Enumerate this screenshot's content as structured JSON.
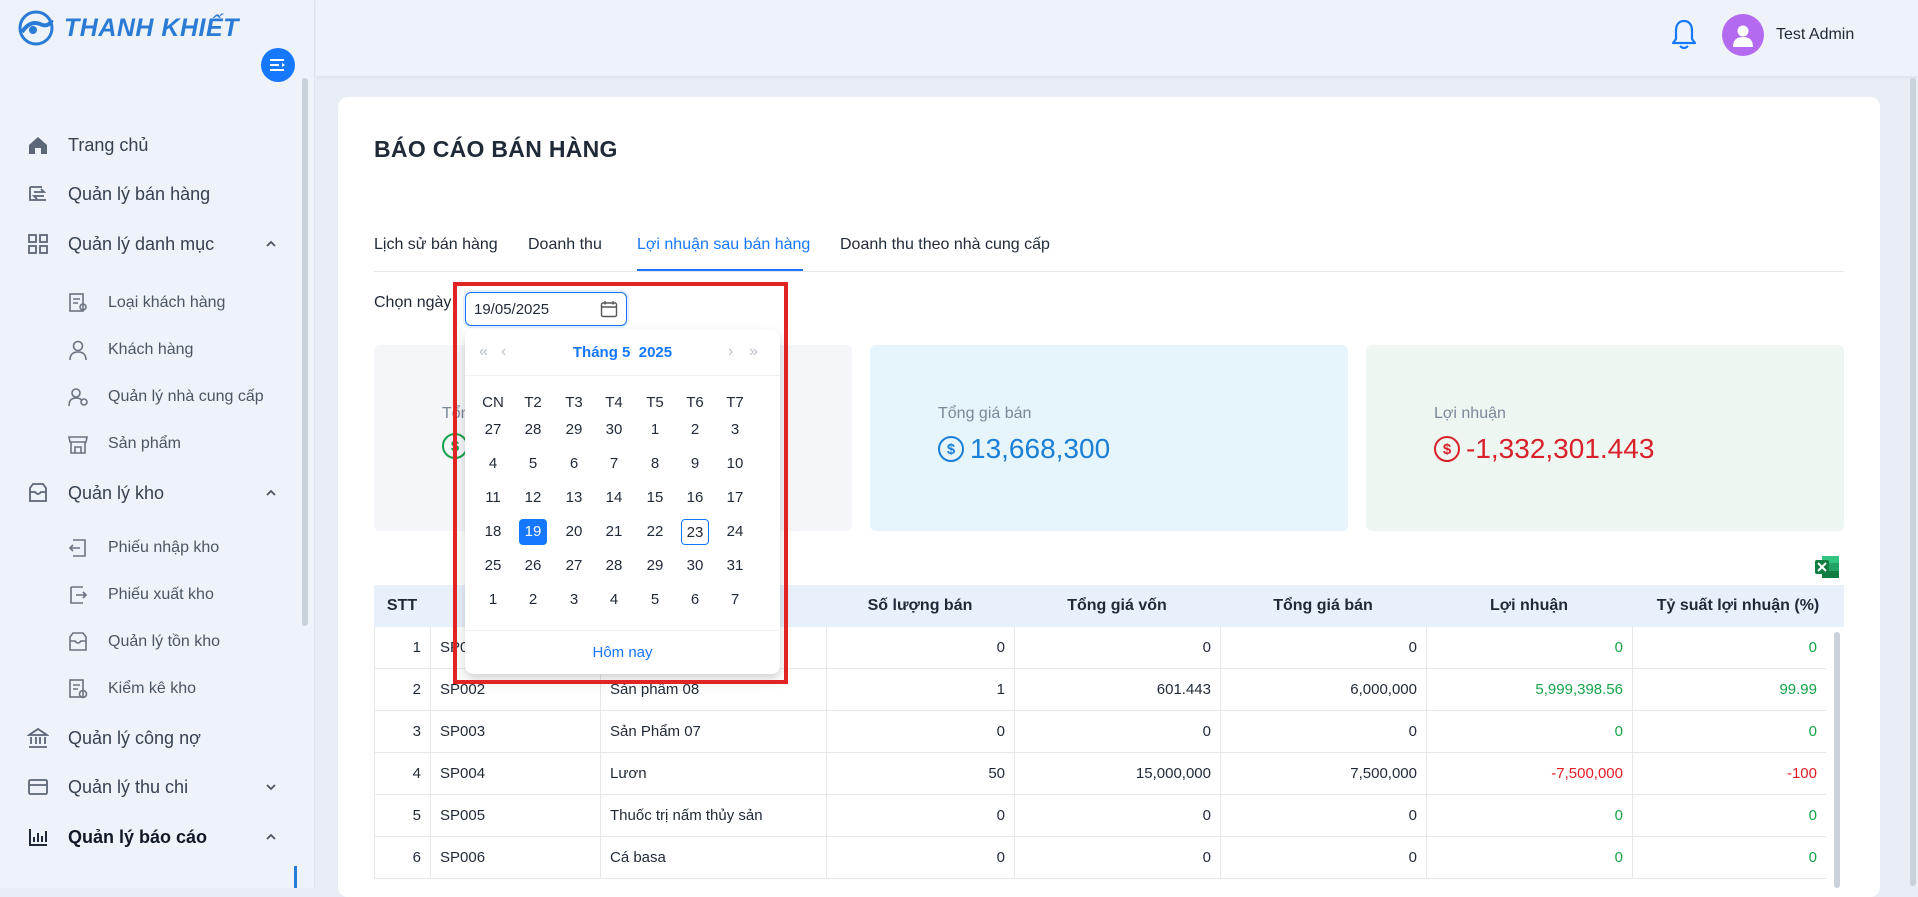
{
  "brand": {
    "name": "THANH KHIẾT"
  },
  "sidebar": {
    "items": [
      {
        "label": "Trang chủ",
        "icon": "home-icon"
      },
      {
        "label": "Quản lý bán hàng",
        "icon": "sales-icon"
      },
      {
        "label": "Quản lý danh mục",
        "icon": "grid-icon",
        "expanded": true
      },
      {
        "label": "Loại khách hàng",
        "icon": "customer-type-icon",
        "sub": true
      },
      {
        "label": "Khách hàng",
        "icon": "user-icon",
        "sub": true
      },
      {
        "label": "Quản lý nhà cung cấp",
        "icon": "supplier-icon",
        "sub": true
      },
      {
        "label": "Sản phẩm",
        "icon": "store-icon",
        "sub": true
      },
      {
        "label": "Quản lý kho",
        "icon": "inbox-icon",
        "expanded": true
      },
      {
        "label": "Phiếu nhập kho",
        "icon": "import-icon",
        "sub": true
      },
      {
        "label": "Phiếu xuất kho",
        "icon": "export-icon",
        "sub": true
      },
      {
        "label": "Quản lý tồn kho",
        "icon": "stock-icon",
        "sub": true
      },
      {
        "label": "Kiểm kê kho",
        "icon": "audit-icon",
        "sub": true
      },
      {
        "label": "Quản lý công nợ",
        "icon": "bank-icon"
      },
      {
        "label": "Quản lý thu chi",
        "icon": "wallet-icon",
        "expanded": false
      },
      {
        "label": "Quản lý báo cáo",
        "icon": "chart-icon",
        "expanded": true
      }
    ]
  },
  "header": {
    "user_name": "Test Admin"
  },
  "page": {
    "title": "BÁO CÁO BÁN HÀNG"
  },
  "tabs": [
    {
      "label": "Lịch sử bán hàng"
    },
    {
      "label": "Doanh thu"
    },
    {
      "label": "Lợi nhuận sau bán hàng",
      "active": true
    },
    {
      "label": "Doanh thu theo nhà cung cấp"
    }
  ],
  "filter": {
    "label": "Chọn ngày",
    "date_value": "19/05/2025"
  },
  "stats": [
    {
      "title": "Tổng giá vốn",
      "value": ""
    },
    {
      "title": "Tổng giá bán",
      "value": "13,668,300",
      "color": "#1a7fd6",
      "bg": "#e6f4fb"
    },
    {
      "title": "Lợi nhuận",
      "value": "-1,332,301.443",
      "color": "#d9212c",
      "bg": "#eef6f2"
    }
  ],
  "datepicker": {
    "month_label": "Tháng 5",
    "year_label": "2025",
    "weekdays": [
      "CN",
      "T2",
      "T3",
      "T4",
      "T5",
      "T6",
      "T7"
    ],
    "weeks": [
      [
        27,
        28,
        29,
        30,
        1,
        2,
        3
      ],
      [
        4,
        5,
        6,
        7,
        8,
        9,
        10
      ],
      [
        11,
        12,
        13,
        14,
        15,
        16,
        17
      ],
      [
        18,
        19,
        20,
        21,
        22,
        23,
        24
      ],
      [
        25,
        26,
        27,
        28,
        29,
        30,
        31
      ],
      [
        1,
        2,
        3,
        4,
        5,
        6,
        7
      ]
    ],
    "selected_day": 19,
    "today_day": 23,
    "today_label": "Hôm nay"
  },
  "table": {
    "columns": [
      "STT",
      "Mã sản phẩm",
      "Tên sản phẩm",
      "Số lượng bán",
      "Tổng giá vốn",
      "Tổng giá bán",
      "Lợi nhuận",
      "Tỷ suất lợi nhuận (%)"
    ],
    "rows": [
      {
        "stt": "1",
        "code": "SP0",
        "name": "",
        "qty": "0",
        "cost": "0",
        "sale": "0",
        "profit": "0",
        "ratio": "0",
        "tone": "green"
      },
      {
        "stt": "2",
        "code": "SP002",
        "name": "Sản phẩm 08",
        "qty": "1",
        "cost": "601.443",
        "sale": "6,000,000",
        "profit": "5,999,398.56",
        "ratio": "99.99",
        "tone": "green"
      },
      {
        "stt": "3",
        "code": "SP003",
        "name": "Sản Phẩm 07",
        "qty": "0",
        "cost": "0",
        "sale": "0",
        "profit": "0",
        "ratio": "0",
        "tone": "green"
      },
      {
        "stt": "4",
        "code": "SP004",
        "name": "Lươn",
        "qty": "50",
        "cost": "15,000,000",
        "sale": "7,500,000",
        "profit": "-7,500,000",
        "ratio": "-100",
        "tone": "red"
      },
      {
        "stt": "5",
        "code": "SP005",
        "name": "Thuốc trị nấm thủy sản",
        "qty": "0",
        "cost": "0",
        "sale": "0",
        "profit": "0",
        "ratio": "0",
        "tone": "green"
      },
      {
        "stt": "6",
        "code": "SP006",
        "name": "Cá basa",
        "qty": "0",
        "cost": "0",
        "sale": "0",
        "profit": "0",
        "ratio": "0",
        "tone": "green"
      }
    ]
  }
}
